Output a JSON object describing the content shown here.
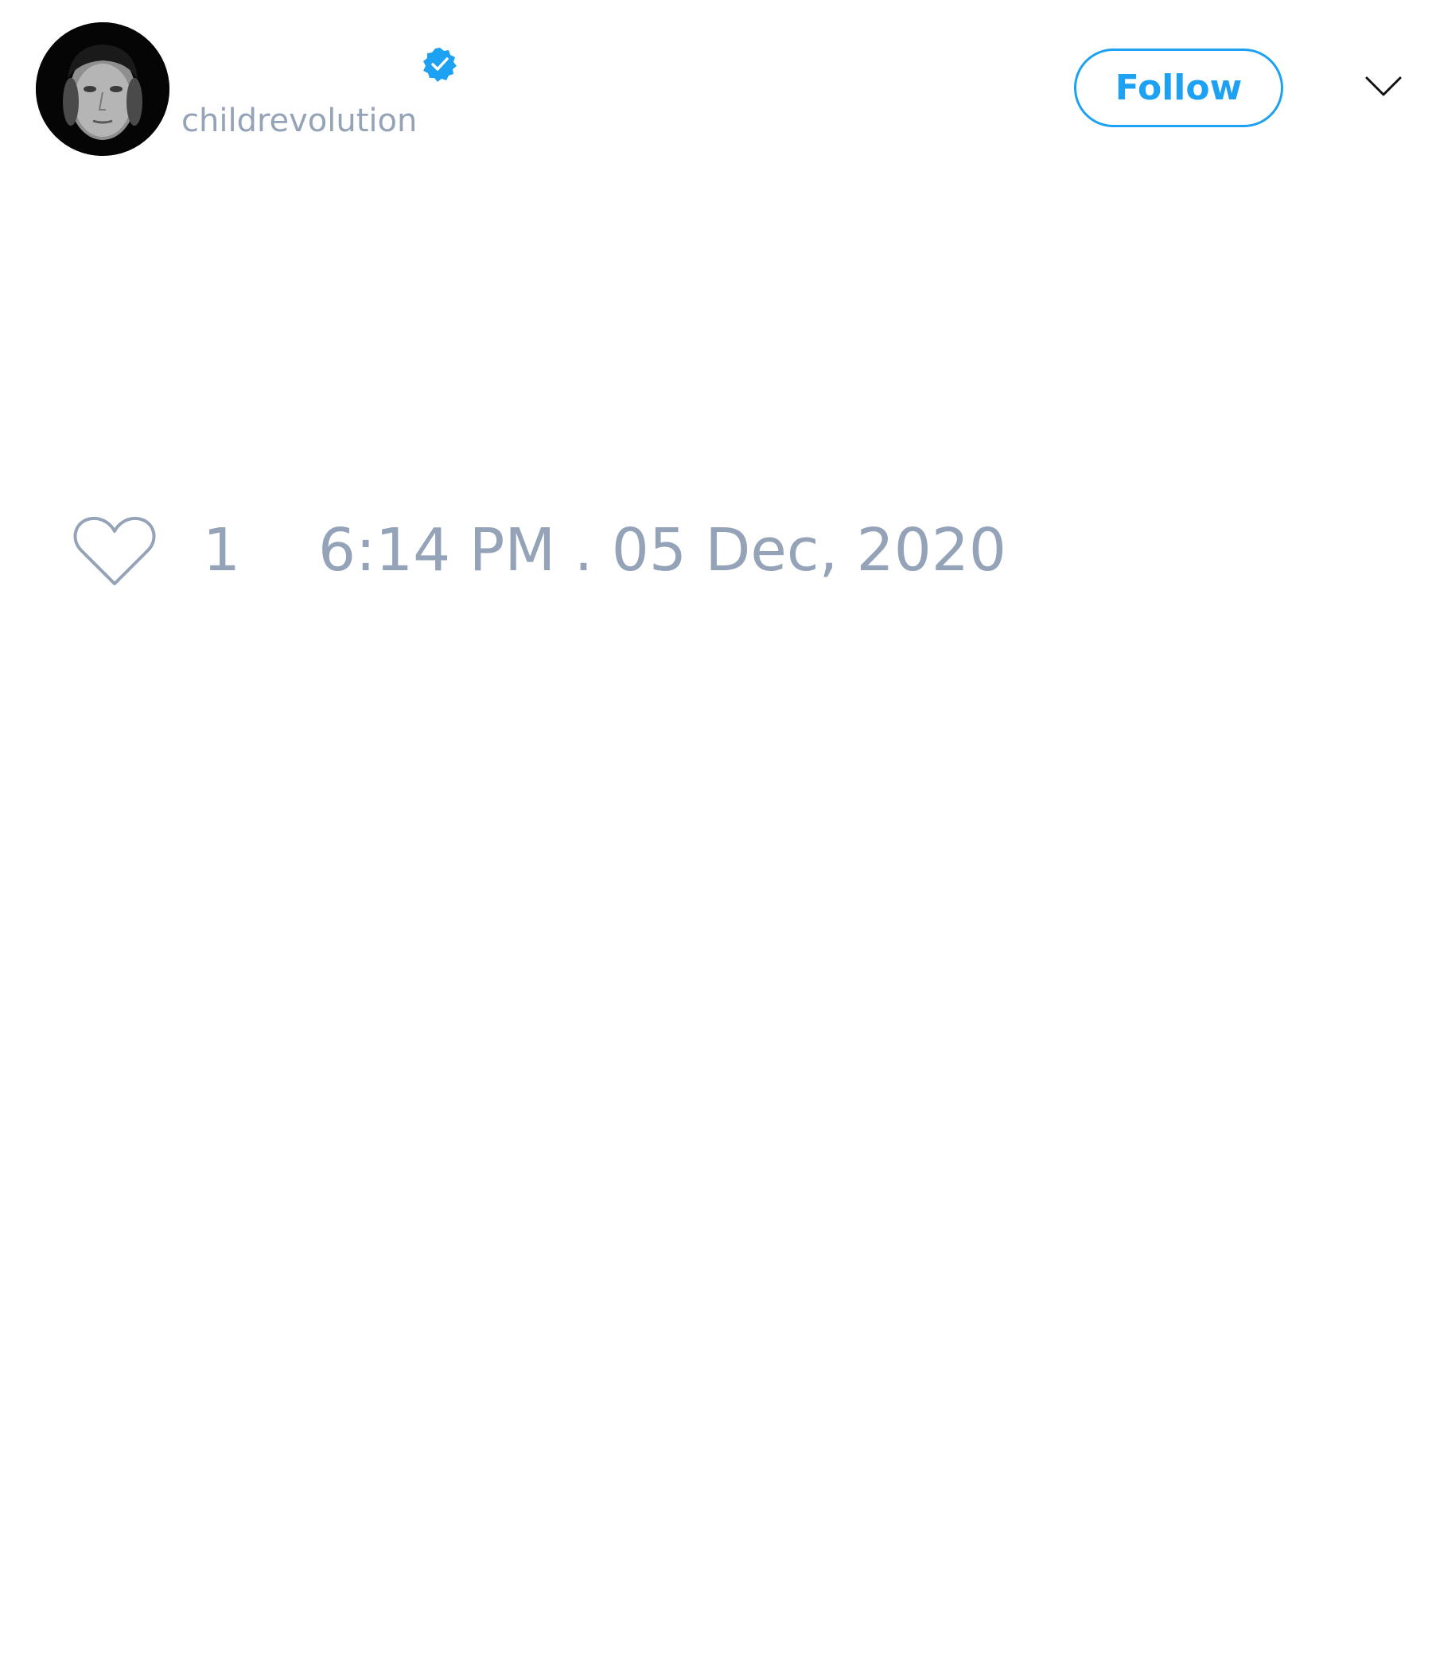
{
  "tweet": {
    "author": {
      "handle": "childrevolution",
      "verified": true,
      "avatar_icon": "profile-photo-avatar"
    },
    "follow_label": "Follow",
    "more_icon": "chevron-down-icon",
    "likes": {
      "icon": "heart-icon",
      "count": "1"
    },
    "timestamp": "6:14 PM . 05 Dec, 2020"
  },
  "colors": {
    "accent": "#1da1f2",
    "muted_text": "#94a3b8",
    "background": "#ffffff"
  }
}
